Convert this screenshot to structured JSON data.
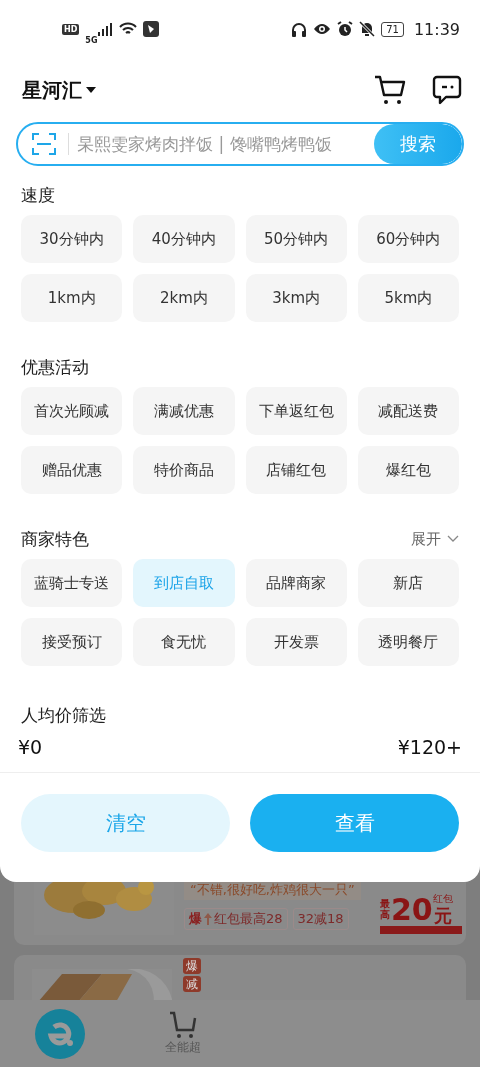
{
  "status_bar": {
    "hd": "HD",
    "network": "5G",
    "battery": "71",
    "time": "11:39"
  },
  "header": {
    "location": "星河汇"
  },
  "search": {
    "placeholder": "杲熙雯家烤肉拌饭 | 馋嘴鸭烤鸭饭",
    "button": "搜索"
  },
  "sections": [
    {
      "title": "速度",
      "options": [
        {
          "label": "30分钟内",
          "selected": false
        },
        {
          "label": "40分钟内",
          "selected": false
        },
        {
          "label": "50分钟内",
          "selected": false
        },
        {
          "label": "60分钟内",
          "selected": false
        },
        {
          "label": "1km内",
          "selected": false
        },
        {
          "label": "2km内",
          "selected": false
        },
        {
          "label": "3km内",
          "selected": false
        },
        {
          "label": "5km内",
          "selected": false
        }
      ]
    },
    {
      "title": "优惠活动",
      "options": [
        {
          "label": "首次光顾减",
          "selected": false
        },
        {
          "label": "满减优惠",
          "selected": false
        },
        {
          "label": "下单返红包",
          "selected": false
        },
        {
          "label": "减配送费",
          "selected": false
        },
        {
          "label": "赠品优惠",
          "selected": false
        },
        {
          "label": "特价商品",
          "selected": false
        },
        {
          "label": "店铺红包",
          "selected": false
        },
        {
          "label": "爆红包",
          "selected": false
        }
      ]
    },
    {
      "title": "商家特色",
      "toggle": "展开",
      "options": [
        {
          "label": "蓝骑士专送",
          "selected": false
        },
        {
          "label": "到店自取",
          "selected": true
        },
        {
          "label": "品牌商家",
          "selected": false
        },
        {
          "label": "新店",
          "selected": false
        },
        {
          "label": "接受预订",
          "selected": false
        },
        {
          "label": "食无忧",
          "selected": false
        },
        {
          "label": "开发票",
          "selected": false
        },
        {
          "label": "透明餐厅",
          "selected": false
        }
      ]
    }
  ],
  "price_filter": {
    "title": "人均价筛选",
    "min": "¥0",
    "max": "¥120+"
  },
  "actions": [
    {
      "label": "清空",
      "kind": "secondary"
    },
    {
      "label": "查看",
      "kind": "primary"
    }
  ],
  "background": {
    "card": {
      "quote": "“不错,很好吃,炸鸡很大一只”",
      "tags": [
        {
          "kind": "boom",
          "prefix": "爆",
          "label": "红包最高28"
        },
        {
          "kind": "plain",
          "label": "32减18"
        }
      ],
      "coupon": {
        "top": "最高",
        "amount": "20",
        "unit": "元",
        "note": "红包"
      }
    },
    "card_2": {
      "tags": [
        "爆",
        "减"
      ]
    },
    "nav": [
      {
        "kind": "logo"
      },
      {
        "kind": "cart",
        "label": "全能超"
      }
    ]
  }
}
